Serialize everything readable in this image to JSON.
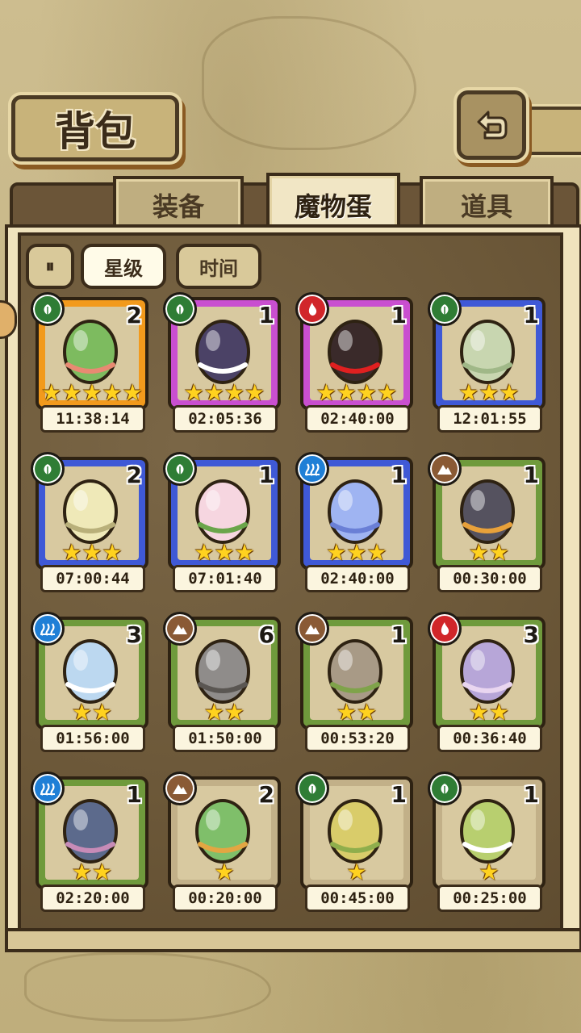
{
  "header": {
    "title": "背包",
    "back_icon": "return-arrow-icon"
  },
  "tabs": [
    {
      "label": "装备",
      "active": false
    },
    {
      "label": "魔物蛋",
      "active": true
    },
    {
      "label": "道具",
      "active": false
    }
  ],
  "filters": {
    "toggle_icon": "pause-toggle-icon",
    "toggle_glyph": "⏸",
    "items": [
      {
        "label": "星级",
        "active": true
      },
      {
        "label": "时间",
        "active": false
      }
    ]
  },
  "colors": {
    "tier_gold": "#f29a1c",
    "tier_purple": "#c94fd0",
    "tier_blue": "#3f59d6",
    "tier_green": "#6f9a3c",
    "tier_tan": "#c2b088",
    "elem_leaf": "#2f7d35",
    "elem_fire": "#d1262a",
    "elem_water": "#1f7fd6",
    "elem_earth": "#8a5a35"
  },
  "eggs": [
    {
      "count": "2",
      "stars": "★★★★★",
      "time": "11:38:14",
      "element": "leaf",
      "tier": "gold",
      "egg_color": "#7dbb5f",
      "accent": "#e88a72"
    },
    {
      "count": "1",
      "stars": "★★★★",
      "time": "02:05:36",
      "element": "leaf",
      "tier": "purple",
      "egg_color": "#4b4266",
      "accent": "#ffffff"
    },
    {
      "count": "1",
      "stars": "★★★★",
      "time": "02:40:00",
      "element": "fire",
      "tier": "purple",
      "egg_color": "#3a2a2a",
      "accent": "#e02020"
    },
    {
      "count": "1",
      "stars": "★★★",
      "time": "12:01:55",
      "element": "leaf",
      "tier": "blue",
      "egg_color": "#c8d6b0",
      "accent": "#a0b888"
    },
    {
      "count": "2",
      "stars": "★★★",
      "time": "07:00:44",
      "element": "leaf",
      "tier": "blue",
      "egg_color": "#efe9b8",
      "accent": "#b9b07a"
    },
    {
      "count": "1",
      "stars": "★★★",
      "time": "07:01:40",
      "element": "leaf",
      "tier": "blue",
      "egg_color": "#f6d6e0",
      "accent": "#6aa54a"
    },
    {
      "count": "1",
      "stars": "★★★",
      "time": "02:40:00",
      "element": "water",
      "tier": "blue",
      "egg_color": "#9fb4f2",
      "accent": "#6a7fd6"
    },
    {
      "count": "1",
      "stars": "★★",
      "time": "00:30:00",
      "element": "earth",
      "tier": "green",
      "egg_color": "#55525f",
      "accent": "#e8a13a"
    },
    {
      "count": "3",
      "stars": "★★",
      "time": "01:56:00",
      "element": "water",
      "tier": "green",
      "egg_color": "#bcd8f0",
      "accent": "#ffffff"
    },
    {
      "count": "6",
      "stars": "★★",
      "time": "01:50:00",
      "element": "earth",
      "tier": "green",
      "egg_color": "#8f8c8a",
      "accent": "#5a5652"
    },
    {
      "count": "1",
      "stars": "★★",
      "time": "00:53:20",
      "element": "earth",
      "tier": "green",
      "egg_color": "#a89a86",
      "accent": "#7fa34a"
    },
    {
      "count": "3",
      "stars": "★★",
      "time": "00:36:40",
      "element": "fire",
      "tier": "green",
      "egg_color": "#b7a6d8",
      "accent": "#e9d6f0"
    },
    {
      "count": "1",
      "stars": "★★",
      "time": "02:20:00",
      "element": "water",
      "tier": "green",
      "egg_color": "#5c6a8c",
      "accent": "#c78bb7"
    },
    {
      "count": "2",
      "stars": "★",
      "time": "00:20:00",
      "element": "earth",
      "tier": "tan",
      "egg_color": "#7fbf6a",
      "accent": "#e3a642"
    },
    {
      "count": "1",
      "stars": "★",
      "time": "00:45:00",
      "element": "leaf",
      "tier": "tan",
      "egg_color": "#d9cc6a",
      "accent": "#8fae4c"
    },
    {
      "count": "1",
      "stars": "★",
      "time": "00:25:00",
      "element": "leaf",
      "tier": "tan",
      "egg_color": "#b8cf6f",
      "accent": "#ffffff"
    }
  ]
}
